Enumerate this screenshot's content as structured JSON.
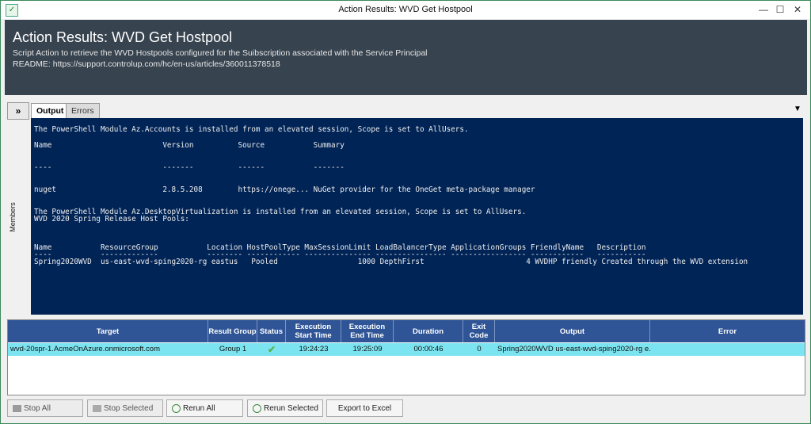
{
  "window": {
    "title": "Action Results: WVD Get Hostpool",
    "minimize": "—",
    "maximize": "☐",
    "close": "✕"
  },
  "header": {
    "title": "Action Results: WVD Get Hostpool",
    "description": "Script Action to retrieve the WVD Hostpools configured for the Suibscription associated with the Service Principal",
    "readme": "README: https://support.controlup.com/hc/en-us/articles/360011378518"
  },
  "side": {
    "expand_label": "»",
    "members_label": "Members"
  },
  "tabs": [
    {
      "label": "Output",
      "active": true
    },
    {
      "label": "Errors",
      "active": false
    }
  ],
  "console_lines": [
    "The PowerShell Module Az.Accounts is installed from an elevated session, Scope is set to AllUsers.",
    "Name                         Version          Source           Summary",
    "----                         -------          ------           -------",
    "nuget                        2.8.5.208        https://onege... NuGet provider for the OneGet meta-package manager",
    "The PowerShell Module Az.DesktopVirtualization is installed from an elevated session, Scope is set to AllUsers.",
    "WVD 2020 Spring Release Host Pools:",
    "Name           ResourceGroup           Location HostPoolType MaxSessionLimit LoadBalancerType ApplicationGroups FriendlyName   Description",
    "----           -------------           -------- ------------ --------------- ---------------- ----------------- ------------   -----------",
    "Spring2020WVD  us-east-wvd-sping2020-rg eastus   Pooled                  1000 DepthFirst                       4 WVDHP friendly Created through the WVD extension"
  ],
  "grid": {
    "columns": [
      "Target",
      "Result Group",
      "Status",
      "Execution Start Time",
      "Execution End Time",
      "Duration",
      "Exit Code",
      "Output",
      "Error"
    ],
    "row": {
      "target": "wvd-20spr-1.AcmeOnAzure.onmicrosoft.com",
      "result_group": "Group 1",
      "status": "✔",
      "start": "19:24:23",
      "end": "19:25:09",
      "duration": "00:00:46",
      "exit_code": "0",
      "output": "Spring2020WVD us-east-wvd-sping2020-rg e...",
      "error": ""
    }
  },
  "buttons": {
    "stop_all": "Stop All",
    "stop_selected": "Stop Selected",
    "rerun_all": "Rerun All",
    "rerun_selected": "Rerun Selected",
    "export": "Export to Excel"
  }
}
